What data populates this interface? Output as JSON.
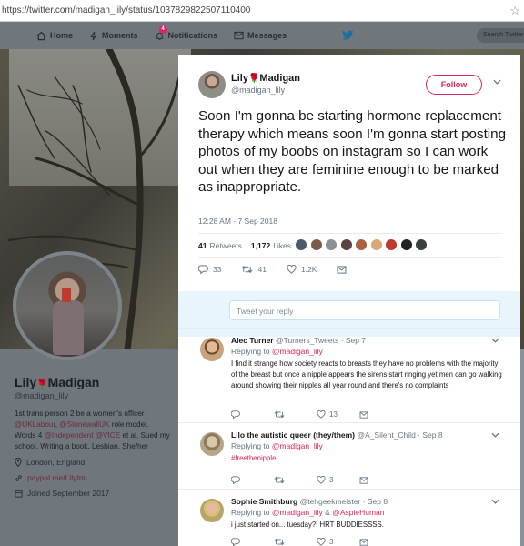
{
  "browser": {
    "url": "https://twitter.com/madigan_lily/status/1037829822507110400"
  },
  "nav": {
    "home": "Home",
    "moments": "Moments",
    "notifications": "Notifications",
    "notifications_badge": "4",
    "messages": "Messages",
    "search_placeholder": "Search Twitter"
  },
  "profile": {
    "name": "Lily",
    "name_suffix": "Madigan",
    "handle": "@madigan_lily",
    "bio_1": "1st trans person 2 be a women's officer ",
    "bio_l1": "@UKLabour",
    "bio_2": ", ",
    "bio_l2": "@StonewallUK",
    "bio_3": " role model. Words 4 ",
    "bio_l3": "@Independent",
    "bio_4": " ",
    "bio_l4": "@VICE",
    "bio_5": " et al. Sued my school. Writing a book. Lesbian. She/her",
    "location": "London, England",
    "website": "paypal.me/Lilytm",
    "joined": "Joined September 2017"
  },
  "tweet": {
    "display_name": "Lily",
    "display_name_suffix": "Madigan",
    "handle": "@madigan_lily",
    "follow_label": "Follow",
    "text": "Soon I'm gonna be starting hormone replacement therapy which means soon I'm gonna start posting photos of my boobs on instagram so I can work out when they are feminine enough to be marked as inappropriate.",
    "timestamp": "12:28 AM - 7 Sep 2018",
    "retweets_count": "41",
    "retweets_label": "Retweets",
    "likes_count": "1,172",
    "likes_label": "Likes",
    "reply_count": "33",
    "retweet_count": "41",
    "like_count": "1.2K",
    "reply_placeholder": "Tweet your reply"
  },
  "colors": {
    "accent": "#e0245e",
    "link": "#e0245e",
    "muted": "#657786",
    "twitter_blue": "#1da1f2"
  },
  "replies": [
    {
      "name": "Alec Turner",
      "handle": "@Turners_Tweets",
      "date": "· Sep 7",
      "replying_label": "Replying to",
      "replying_to": "@madigan_lily",
      "text": "I find it strange how society reacts to breasts they have no problems with the majority of the breast but once a nipple appears the sirens start ringing yet men can go walking around showing their nipples all year round and there's no complaints",
      "likes": "13"
    },
    {
      "name": "Lilo the autistic queer (they/them)",
      "handle": "@A_Silent_Child",
      "date": "· Sep 8",
      "replying_label": "Replying to",
      "replying_to": "@madigan_lily",
      "text": "#freethenipple",
      "likes": "3"
    },
    {
      "name": "Sophie Smithburg",
      "handle": "@tehgeekmeister",
      "date": "· Sep 8",
      "replying_label": "Replying to",
      "replying_to": "@madigan_lily",
      "replying_and": "&",
      "replying_to_2": "@AspieHuman",
      "text": "i just started on... tuesday?! HRT BUDDIESSSS.",
      "likes": "3"
    }
  ]
}
